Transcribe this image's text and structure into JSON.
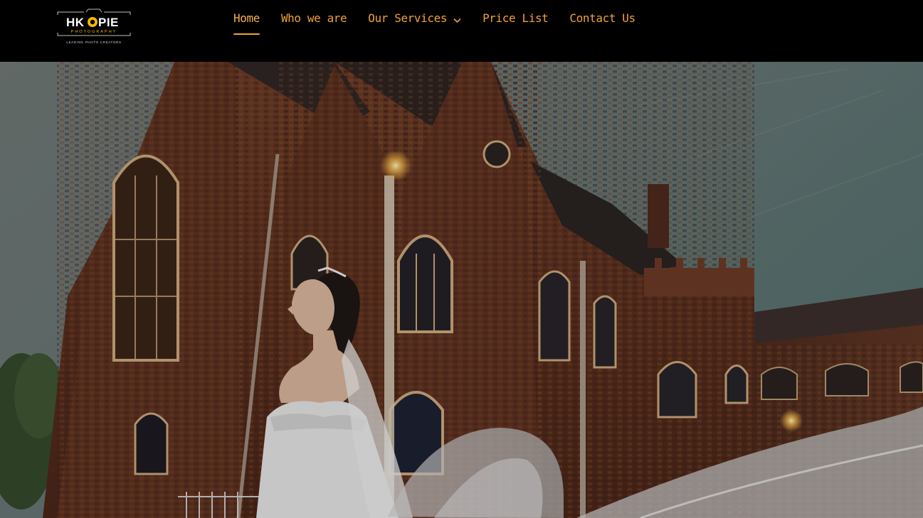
{
  "brand": {
    "logo_title": "HKOPIE",
    "logo_subtitle": "PHOTOGRAPHY",
    "logo_tagline": "LEADING PHOTO CREATORS"
  },
  "nav": {
    "items": [
      {
        "label": "Home",
        "active": true
      },
      {
        "label": "Who we are",
        "active": false
      },
      {
        "label": "Our Services",
        "active": false,
        "has_dropdown": true
      },
      {
        "label": "Price List",
        "active": false
      },
      {
        "label": "Contact Us",
        "active": false
      }
    ]
  },
  "hero": {
    "image_subject": "bride-in-veil-before-gothic-brick-building"
  },
  "colors": {
    "header_bg": "#000000",
    "nav_text": "#f0a23a",
    "logo_accent": "#f5b800"
  },
  "icons": {
    "dropdown": "chevron-down-icon",
    "logo_mark": "camera-aperture-icon"
  }
}
